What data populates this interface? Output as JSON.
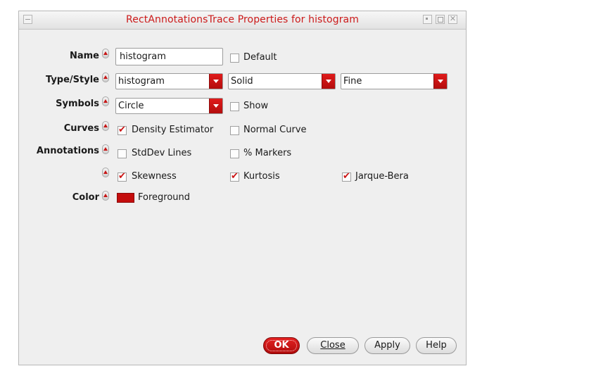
{
  "window": {
    "title": "RectAnnotationsTrace Properties for histogram"
  },
  "name_row": {
    "label": "Name",
    "value": "histogram",
    "default_label": "Default",
    "default_checked": false
  },
  "type_row": {
    "label": "Type/Style",
    "type_value": "histogram",
    "style_value": "Solid",
    "width_value": "Fine"
  },
  "symbols_row": {
    "label": "Symbols",
    "symbol_value": "Circle",
    "show_label": "Show",
    "show_checked": false
  },
  "curves_row": {
    "label": "Curves",
    "density_label": "Density Estimator",
    "density_checked": true,
    "normal_label": "Normal Curve",
    "normal_checked": false
  },
  "annotations_row": {
    "label": "Annotations",
    "stddev_label": "StdDev Lines",
    "stddev_checked": false,
    "markers_label": "% Markers",
    "markers_checked": false,
    "skewness_label": "Skewness",
    "skewness_checked": true,
    "kurtosis_label": "Kurtosis",
    "kurtosis_checked": true,
    "jarque_label": "Jarque-Bera",
    "jarque_checked": true
  },
  "color_row": {
    "label": "Color",
    "color_name": "Foreground",
    "color_hex": "#c40d0d"
  },
  "buttons": {
    "ok": "OK",
    "close": "Close",
    "apply": "Apply",
    "help": "Help"
  },
  "colors": {
    "accent": "#c71515",
    "title": "#cc1a1a"
  }
}
